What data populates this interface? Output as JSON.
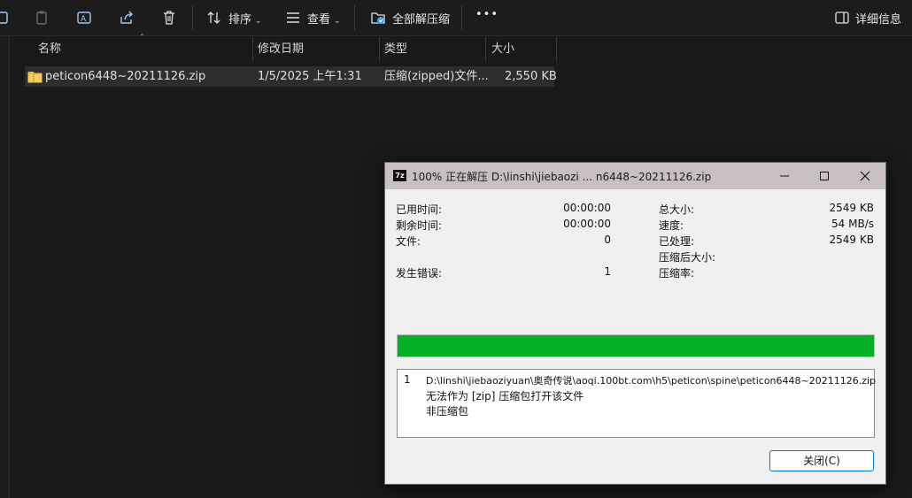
{
  "toolbar": {
    "sort_label": "排序",
    "view_label": "查看",
    "extract_all_label": "全部解压缩",
    "more_label": "•••",
    "details_label": "详细信息"
  },
  "columns": {
    "name": "名称",
    "modified": "修改日期",
    "type": "类型",
    "size": "大小"
  },
  "files": [
    {
      "name": "peticon6448~20211126.zip",
      "modified": "1/5/2025 上午1:31",
      "type": "压缩(zipped)文件...",
      "size": "2,550 KB"
    }
  ],
  "dialog": {
    "title": "100% 正在解压 D:\\linshi\\jiebaozi ... n6448~20211126.zip",
    "left_stats": [
      {
        "label": "已用时间:",
        "value": "00:00:00"
      },
      {
        "label": "剩余时间:",
        "value": "00:00:00"
      },
      {
        "label": "文件:",
        "value": "0"
      },
      {
        "label": "",
        "value": ""
      },
      {
        "label": "发生错误:",
        "value": "1"
      }
    ],
    "right_stats": [
      {
        "label": "总大小:",
        "value": "2549 KB"
      },
      {
        "label": "速度:",
        "value": "54 MB/s"
      },
      {
        "label": "已处理:",
        "value": "2549 KB"
      },
      {
        "label": "压缩后大小:",
        "value": ""
      },
      {
        "label": "压缩率:",
        "value": ""
      }
    ],
    "progress_percent": 100,
    "progress_color": "#06b025",
    "messages": {
      "index": "1",
      "path": "D:\\linshi\\jiebaoziyuan\\奥奇传说\\aoqi.100bt.com\\h5\\peticon\\spine\\peticon6448~20211126.zip",
      "line2": "无法作为 [zip] 压缩包打开该文件",
      "line3": "非压缩包"
    },
    "close_button": "关闭(C)"
  }
}
